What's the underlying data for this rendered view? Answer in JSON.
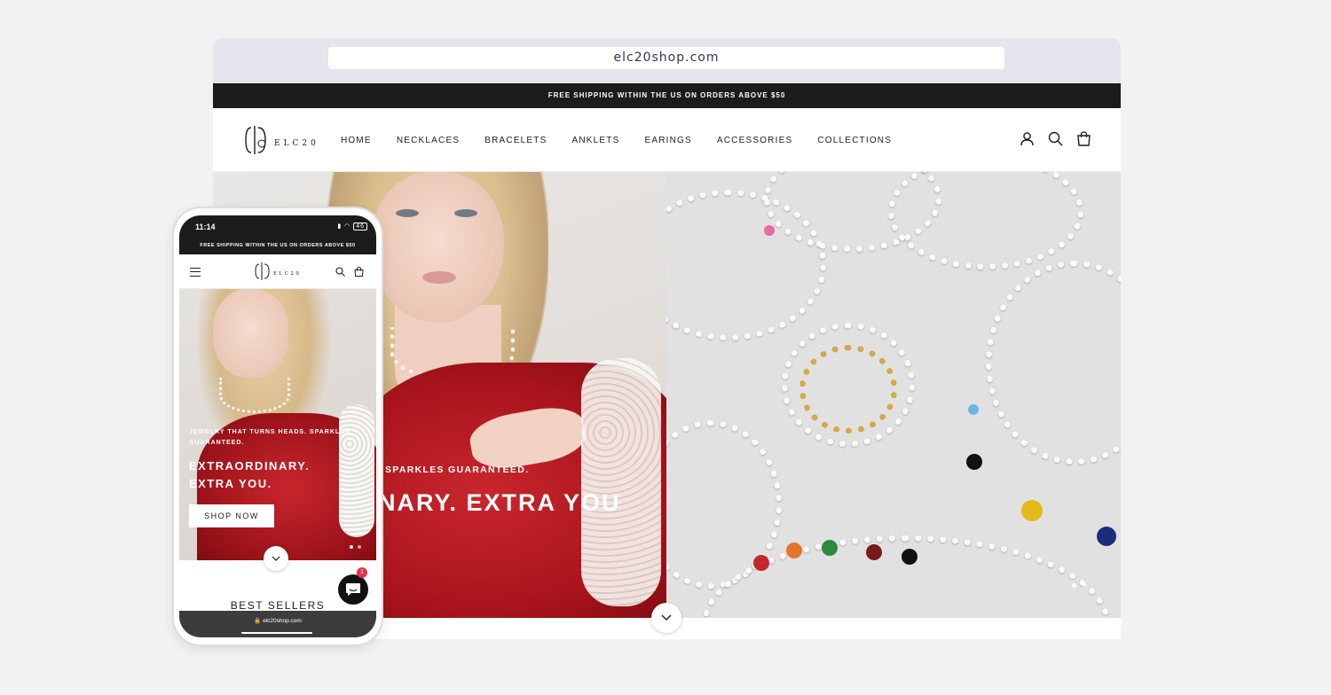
{
  "browser": {
    "url": "elc20shop.com"
  },
  "announcement": "FREE SHIPPING WITHIN THE US ON ORDERS ABOVE $50",
  "logo_text": "ELC20",
  "nav": [
    "HOME",
    "NECKLACES",
    "BRACELETS",
    "ANKLETS",
    "EARINGS",
    "ACCESSORIES",
    "COLLECTIONS"
  ],
  "header_icons": [
    "account-icon",
    "search-icon",
    "cart-icon"
  ],
  "hero": {
    "subtitle": "SPARKLES GUARANTEED.",
    "title": "NARY. EXTRA YOU"
  },
  "phone": {
    "time": "11:14",
    "battery": "46",
    "announcement": "FREE SHIPPING WITHIN THE US ON ORDERS ABOVE $50",
    "hero_subtitle": "JEWELRY THAT TURNS HEADS. SPARKLES GUARANTEED.",
    "hero_title_line1": "EXTRAORDINARY.",
    "hero_title_line2": "EXTRA YOU.",
    "cta": "SHOP NOW",
    "section_title": "BEST SELLERS",
    "url": "elc20shop.com",
    "chat_badge": "1"
  },
  "colors": {
    "announcement_bg": "#1c1c1c",
    "accent_red": "#c9262d",
    "badge": "#e3334b"
  }
}
